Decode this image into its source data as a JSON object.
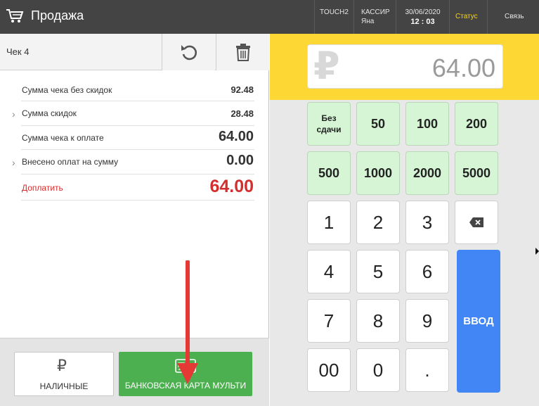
{
  "header": {
    "title": "Продажа",
    "terminal": "TOUCH2",
    "cashier_label": "КАССИР",
    "cashier_name": "Яна",
    "date": "30/06/2020",
    "time": "12 : 03",
    "status": "Статус",
    "link": "Связь",
    "status_color": "#ffd600"
  },
  "check": {
    "title": "Чек 4",
    "undo_icon": "undo-icon",
    "trash_icon": "trash-icon"
  },
  "summary": {
    "rows": [
      {
        "label": "Сумма чека без скидок",
        "value": "92.48"
      },
      {
        "label": "Сумма скидок",
        "value": "28.48"
      },
      {
        "label": "Сумма чека к оплате",
        "value": "64.00"
      },
      {
        "label": "Внесено оплат на сумму",
        "value": "0.00"
      },
      {
        "label": "Доплатить",
        "value": "64.00"
      }
    ],
    "due_color": "#d32f2f"
  },
  "payment": {
    "cash_label": "НАЛИЧНЫЕ",
    "cash_icon": "₽",
    "card_label": "БАНКОВСКАЯ КАРТА МУЛЬТИ",
    "card_color": "#4caf50"
  },
  "display": {
    "currency": "₽",
    "amount": "64.00"
  },
  "keypad": {
    "quick": [
      "Без\nсдачи",
      "50",
      "100",
      "200",
      "500",
      "1000",
      "2000",
      "5000"
    ],
    "digits": [
      "1",
      "2",
      "3",
      "4",
      "5",
      "6",
      "7",
      "8",
      "9",
      "00",
      "0",
      "."
    ],
    "enter": "ВВОД",
    "backspace_icon": "backspace-icon",
    "enter_color": "#4285f4"
  }
}
